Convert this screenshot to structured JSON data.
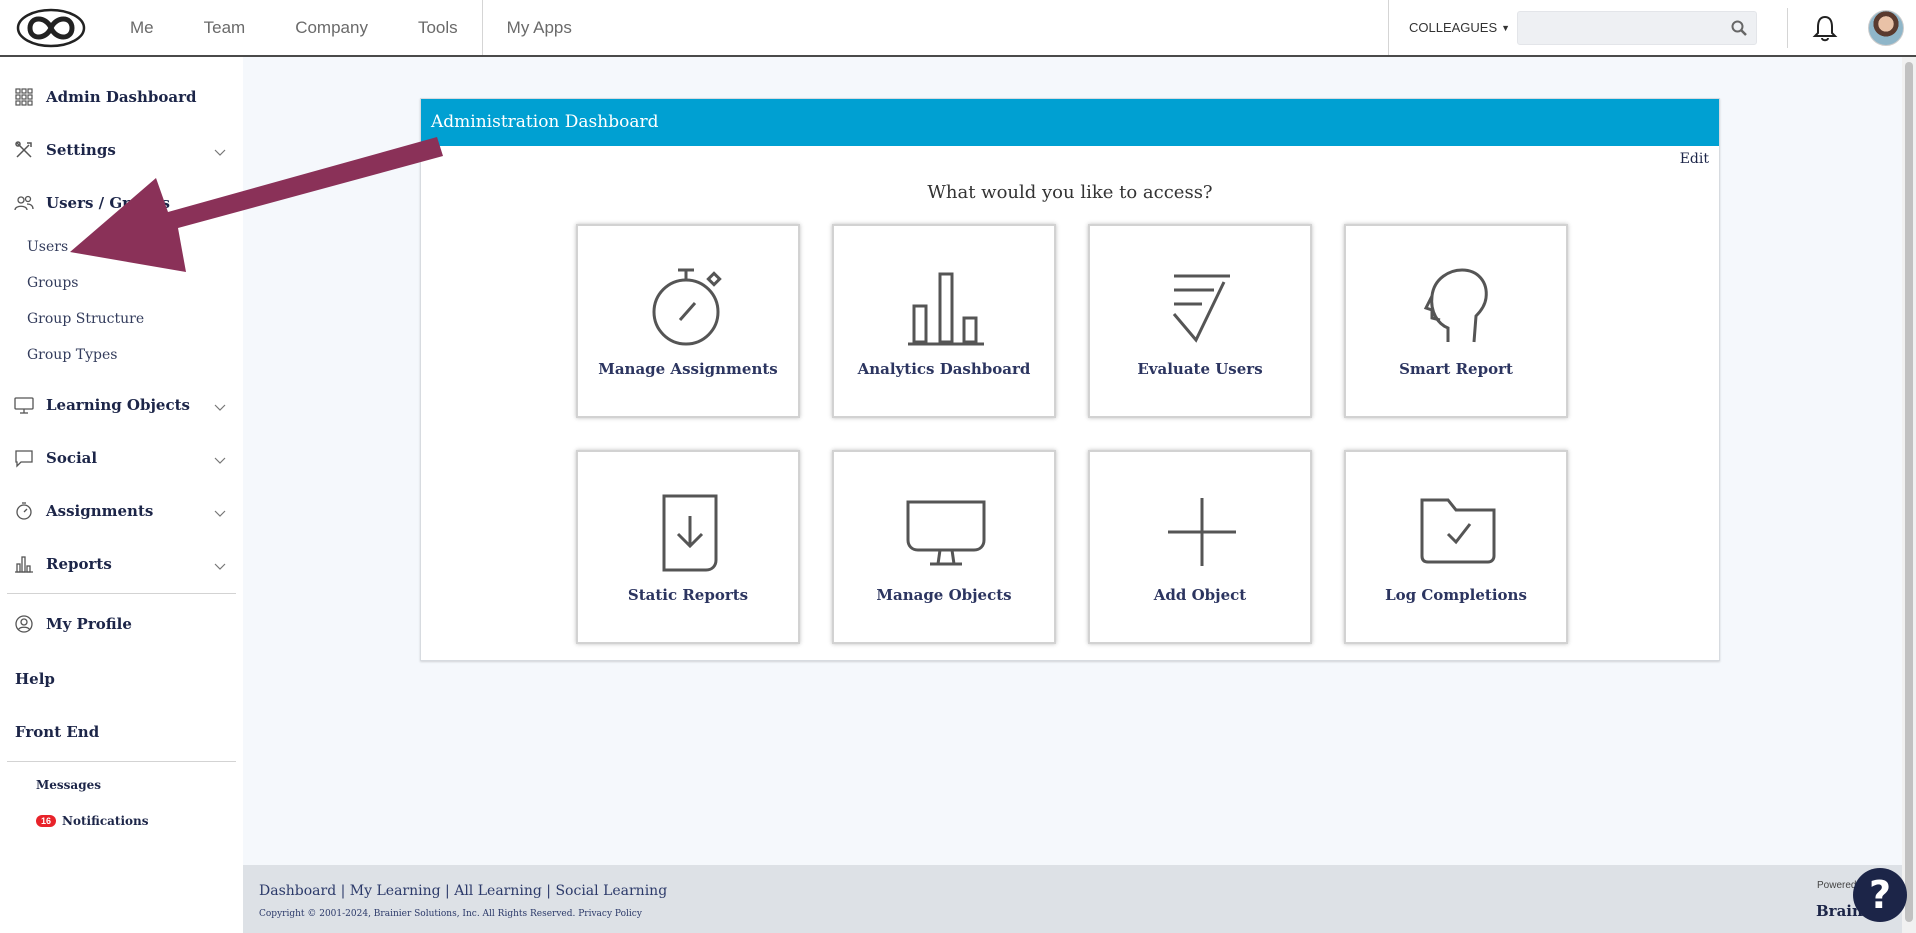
{
  "topbar": {
    "nav": [
      "Me",
      "Team",
      "Company",
      "Tools",
      "My Apps"
    ],
    "colleagues_label": "COLLEAGUES",
    "search_placeholder": ""
  },
  "sidebar": {
    "admin_dashboard": "Admin Dashboard",
    "settings": "Settings",
    "users_groups": "Users / Groups",
    "sub_items": [
      "Users",
      "Groups",
      "Group Structure",
      "Group Types"
    ],
    "learning_objects": "Learning Objects",
    "social": "Social",
    "assignments": "Assignments",
    "reports": "Reports",
    "my_profile": "My Profile",
    "help": "Help",
    "front_end": "Front End",
    "messages": "Messages",
    "notifications": "Notifications",
    "notifications_count": "16"
  },
  "panel": {
    "title": "Administration Dashboard",
    "edit": "Edit",
    "question": "What would you like to access?",
    "tiles": [
      {
        "label": "Manage Assignments",
        "icon": "stopwatch-icon"
      },
      {
        "label": "Analytics Dashboard",
        "icon": "bar-chart-icon"
      },
      {
        "label": "Evaluate Users",
        "icon": "checklist-icon"
      },
      {
        "label": "Smart Report",
        "icon": "head-profile-icon"
      },
      {
        "label": "Static Reports",
        "icon": "download-document-icon"
      },
      {
        "label": "Manage Objects",
        "icon": "monitor-icon"
      },
      {
        "label": "Add Object",
        "icon": "plus-icon"
      },
      {
        "label": "Log Completions",
        "icon": "folder-check-icon"
      }
    ]
  },
  "footer": {
    "links": [
      "Dashboard",
      "My Learning",
      "All Learning",
      "Social Learning"
    ],
    "copyright": "Copyright © 2001-2024, Brainier Solutions, Inc. All Rights Reserved.",
    "privacy": "Privacy Policy",
    "powered": "Powered",
    "brand": "Brain"
  },
  "help_button": "?",
  "colors": {
    "header_blue": "#00a0d2",
    "navy": "#1c2548",
    "annotation_arrow": "#8a3158",
    "badge_red": "#e8232a"
  }
}
